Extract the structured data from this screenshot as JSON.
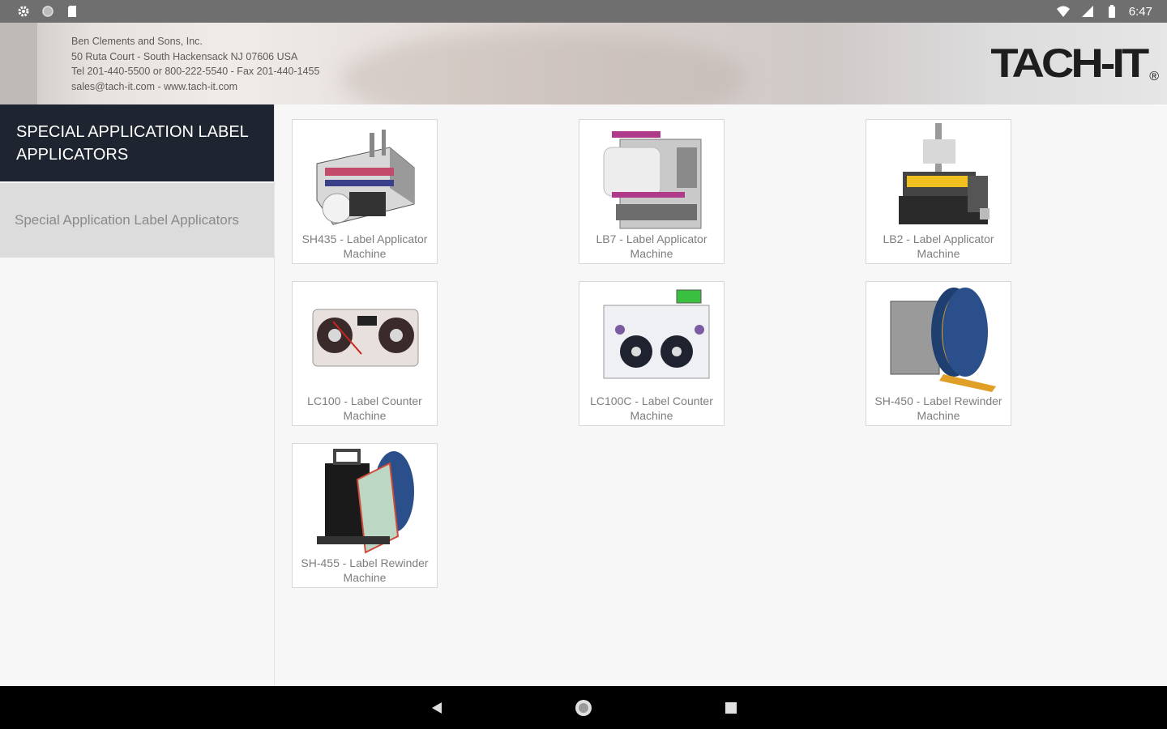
{
  "status_bar": {
    "left_icons": [
      "settings-icon",
      "circle-icon",
      "sd-card-icon"
    ],
    "right_icons": [
      "wifi-icon",
      "signal-icon",
      "battery-icon"
    ],
    "time": "6:47"
  },
  "header": {
    "company_lines": [
      "Ben Clements and Sons, Inc.",
      "50 Ruta Court - South Hackensack NJ 07606 USA",
      "Tel 201-440-5500 or 800-222-5540 - Fax 201-440-1455",
      "sales@tach-it.com - www.tach-it.com"
    ],
    "logo_text": "TACH-IT",
    "logo_mark": "®"
  },
  "sidebar": {
    "title": "SPECIAL APPLICATION LABEL APPLICATORS",
    "items": [
      {
        "label": "Special Application Label Applicators"
      }
    ]
  },
  "products": [
    {
      "label": "SH435 - Label Applicator Machine"
    },
    {
      "label": "LB7 - Label Applicator Machine"
    },
    {
      "label": "LB2 - Label Applicator Machine"
    },
    {
      "label": "LC100 - Label Counter Machine"
    },
    {
      "label": "LC100C - Label Counter Machine"
    },
    {
      "label": "SH-450 - Label Rewinder Machine"
    },
    {
      "label": "SH-455 - Label Rewinder Machine"
    }
  ],
  "nav_bar": {
    "buttons": [
      "back-icon",
      "home-icon",
      "recents-icon"
    ]
  }
}
